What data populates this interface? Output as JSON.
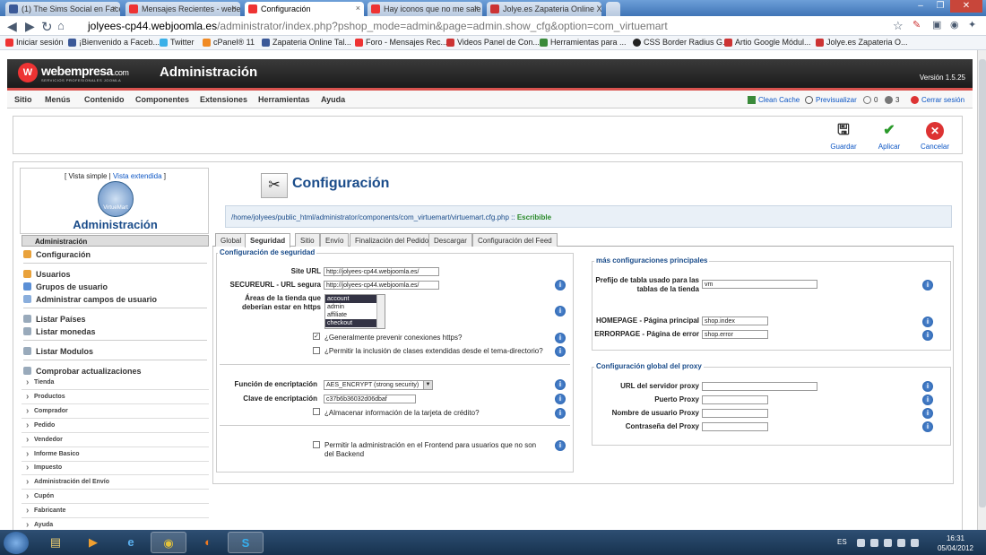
{
  "browser": {
    "tabs": [
      {
        "label": "(1) The Sims Social en Faceb",
        "color": "#3b5998"
      },
      {
        "label": "Mensajes Recientes - webe",
        "color": "#e33"
      },
      {
        "label": "Configuración",
        "color": "#e33"
      },
      {
        "label": "Hay iconos que no me sale",
        "color": "#e33"
      },
      {
        "label": "Jolye.es Zapateria Online X",
        "color": "#c33"
      }
    ],
    "url_host": "jolyees-cp44.webjoomla.es",
    "url_path": "/administrator/index.php?pshop_mode=admin&page=admin.show_cfg&option=com_virtuemart",
    "bookmarks": [
      "Iniciar sesión",
      "¡Bienvenido a Faceb...",
      "Twitter",
      "cPanel® 11",
      "Zapateria Online Tal...",
      "Foro - Mensajes Rec...",
      "Videos Panel de Con...",
      "Herramientas para ...",
      "CSS Border Radius G...",
      "Artio Google Módul...",
      "Jolye.es Zapateria O..."
    ]
  },
  "header": {
    "brand": "webempresa",
    "brand_suffix": ".com",
    "brand_tag": "SERVICIOS PROFESIONALES JOOMLA",
    "title": "Administración",
    "version": "Versión 1.5.25"
  },
  "menu": {
    "items": [
      "Sitio",
      "Menús",
      "Contenido",
      "Componentes",
      "Extensiones",
      "Herramientas",
      "Ayuda"
    ],
    "clean_cache": "Clean Cache",
    "preview": "Previsualizar",
    "messages_count": "0",
    "users_count": "3",
    "logout": "Cerrar sesión"
  },
  "toolbar": {
    "save": "Guardar",
    "apply": "Aplicar",
    "cancel": "Cancelar"
  },
  "sidebar": {
    "view_simple": "[ Vista simple |",
    "view_extended": "Vista extendida",
    "view_close": "]",
    "logo_text": "VirtueMart",
    "title": "Administración",
    "section": "Administración",
    "items_a": [
      "Configuración"
    ],
    "items_b": [
      "Usuarios",
      "Grupos de usuario",
      "Administrar campos de usuario"
    ],
    "items_c": [
      "Listar Países",
      "Listar monedas"
    ],
    "items_d": [
      "Listar Modulos"
    ],
    "items_e": [
      "Comprobar actualizaciones"
    ],
    "categories": [
      "Tienda",
      "Productos",
      "Comprador",
      "Pedido",
      "Vendedor",
      "Informe Basico",
      "Impuesto",
      "Administración del Envío",
      "Cupón",
      "Fabricante",
      "Ayuda"
    ]
  },
  "main": {
    "title": "Configuración",
    "path": "/home/jolyees/public_html/administrator/components/com_virtuemart/virtuemart.cfg.php",
    "path_sep": "::",
    "path_status": "Escribible",
    "tabs": [
      "Global",
      "Seguridad",
      "Sitio",
      "Envío",
      "Finalización del Pedido",
      "Descargar",
      "Configuración del Feed"
    ],
    "active_tab": 1,
    "security": {
      "legend": "Configuración de seguridad",
      "site_url_label": "Site URL",
      "site_url_value": "http://jolyees-cp44.webjoomla.es/",
      "secure_url_label": "SECUREURL - URL segura",
      "secure_url_value": "http://jolyees-cp44.webjoomla.es/",
      "https_areas_label": "Áreas de la tienda que deberían estar en https",
      "https_areas_options": [
        "account",
        "admin",
        "affiliate",
        "checkout"
      ],
      "prevent_https_label": "¿Generalmente prevenir conexiones https?",
      "extended_classes_label": "¿Permitir la inclusión de clases extendidas desde el tema-directorio?",
      "encryption_func_label": "Función de encriptación",
      "encryption_func_value": "AES_ENCRYPT (strong security)",
      "encryption_key_label": "Clave de encriptación",
      "encryption_key_value": "c37b6b36032d06dbaf",
      "store_cc_label": "¿Almacenar información de la tarjeta de crédito?",
      "frontend_admin_label": "Permitir la administración en el Frontend para usuarios que no son del Backend"
    },
    "more": {
      "legend": "más configuraciones principales",
      "table_prefix_label": "Prefijo de tabla usado para las tablas de la tienda",
      "table_prefix_value": "vm",
      "homepage_label": "HOMEPAGE - Página principal",
      "homepage_value": "shop.index",
      "errorpage_label": "ERRORPAGE - Página de error",
      "errorpage_value": "shop.error"
    },
    "proxy": {
      "legend": "Configuración global del proxy",
      "url_label": "URL del servidor proxy",
      "port_label": "Puerto Proxy",
      "user_label": "Nombre de usuario Proxy",
      "pass_label": "Contraseña del Proxy"
    }
  },
  "taskbar": {
    "lang": "ES",
    "time": "16:31",
    "date": "05/04/2012"
  }
}
